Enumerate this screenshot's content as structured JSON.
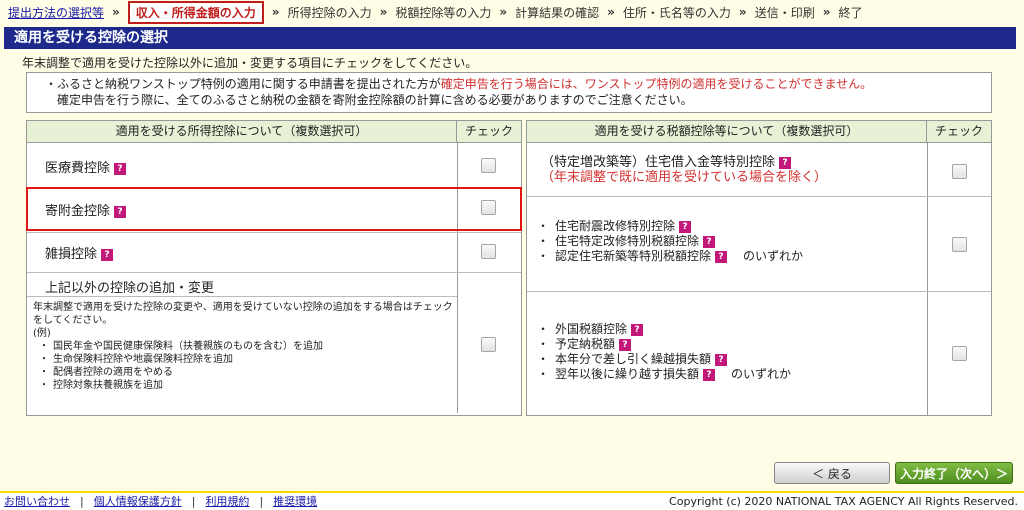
{
  "steps": [
    {
      "label": "提出方法の選択等",
      "state": "link"
    },
    {
      "label": "収入・所得金額の入力",
      "state": "active"
    },
    {
      "label": "所得控除の入力",
      "state": "normal"
    },
    {
      "label": "税額控除等の入力",
      "state": "normal"
    },
    {
      "label": "計算結果の確認",
      "state": "normal"
    },
    {
      "label": "住所・氏名等の入力",
      "state": "normal"
    },
    {
      "label": "送信・印刷",
      "state": "normal"
    },
    {
      "label": "終了",
      "state": "normal"
    }
  ],
  "step_arrow": "»",
  "page_title": "適用を受ける控除の選択",
  "description": "年末調整で適用を受けた控除以外に追加・変更する項目にチェックをしてください。",
  "notice": {
    "bullet": "・",
    "line1_prefix": "ふるさと納税ワンストップ特例の適用に関する申請書を提出された方が",
    "line1_red": "確定申告を行う場合には、ワンストップ特例の適用を受けることができません。",
    "line2": "確定申告を行う際に、全てのふるさと納税の金額を寄附金控除額の計算に含める必要がありますのでご注意ください。"
  },
  "help_icon": "?",
  "left_table": {
    "header": "適用を受ける所得控除について（複数選択可）",
    "check_header": "チェック",
    "rows": [
      {
        "label": "医療費控除",
        "checked": false
      },
      {
        "label": "寄附金控除",
        "checked": false
      },
      {
        "label": "雑損控除",
        "checked": false
      }
    ],
    "other_title": "上記以外の控除の追加・変更",
    "other_desc": "年末調整で適用を受けた控除の変更や、適用を受けていない控除の追加をする場合はチェックをしてください。",
    "other_example": "(例)",
    "other_items": [
      "国民年金や国民健康保険料（扶養親族のものを含む）を追加",
      "生命保険料控除や地震保険料控除を追加",
      "配偶者控除の適用をやめる",
      "控除対象扶養親族を追加"
    ]
  },
  "right_table": {
    "header": "適用を受ける税額控除等について（複数選択可）",
    "check_header": "チェック",
    "row1_label": "（特定増改築等）住宅借入金等特別控除",
    "row1_note": "（年末調整で既に適用を受けている場合を除く）",
    "row2_items": [
      "住宅耐震改修特別控除",
      "住宅特定改修特別税額控除",
      "認定住宅新築等特別税額控除"
    ],
    "row2_suffix": "のいずれか",
    "row3_items": [
      "外国税額控除",
      "予定納税額",
      "本年分で差し引く繰越損失額",
      "翌年以後に繰り越す損失額"
    ],
    "row3_suffix": "のいずれか"
  },
  "buttons": {
    "back": "＜ 戻る",
    "next": "入力終了（次へ）＞"
  },
  "footer": {
    "links": [
      "お問い合わせ",
      "個人情報保護方針",
      "利用規約",
      "推奨環境"
    ],
    "separator": "|",
    "copyright": "Copyright (c) 2020 NATIONAL TAX AGENCY All Rights Reserved."
  },
  "colors": {
    "title_bar": "#1d2a8c",
    "highlight": "#e01616",
    "help_icon": "#c2187a",
    "next_button": "#5f9f2b"
  }
}
